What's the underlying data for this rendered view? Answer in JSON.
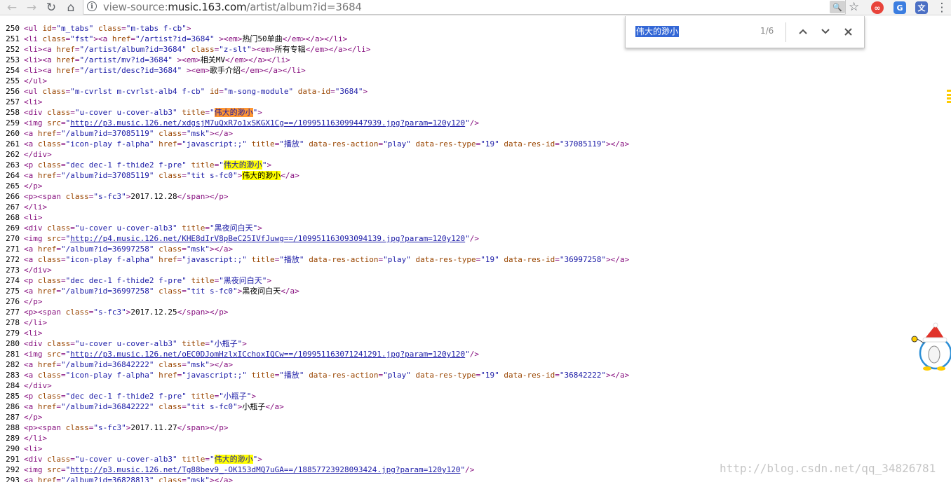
{
  "toolbar": {
    "back_icon": "arrow-back",
    "forward_icon": "arrow-forward",
    "reload_icon": "reload",
    "home_icon": "home",
    "url_scheme": "view-source:",
    "url_host": "music.163.com",
    "url_path": "/artist/album?id=3684",
    "star_icon": "star",
    "find_icon": "find-in-page"
  },
  "find_bar": {
    "query": "伟大的渺小",
    "count": "1/6",
    "prev_icon": "chevron-up",
    "next_icon": "chevron-down",
    "close_icon": "close"
  },
  "watermark": "http://blog.csdn.net/qq_34826781",
  "colors": {
    "match_highlight": "#ffff00",
    "active_match": "#ff9632",
    "tag": "#881280",
    "attr": "#994500",
    "value": "#1a1aa6"
  },
  "lines": [
    {
      "n": "250",
      "code": "<ul id=\"m_tabs\" class=\"m-tabs f-cb\">"
    },
    {
      "n": "251",
      "code": "<li class=\"fst\"><a href=\"/artist?id=3684\" ><em>热门50单曲</em></a></li>"
    },
    {
      "n": "252",
      "code": "<li><a href=\"/artist/album?id=3684\" class=\"z-slt\"><em>所有专辑</em></a></li>"
    },
    {
      "n": "253",
      "code": "<li><a href=\"/artist/mv?id=3684\" ><em>相关MV</em></a></li>"
    },
    {
      "n": "254",
      "code": "<li><a href=\"/artist/desc?id=3684\" ><em>歌手介绍</em></a></li>"
    },
    {
      "n": "255",
      "code": "</ul>"
    },
    {
      "n": "256",
      "code": "<ul class=\"m-cvrlst m-cvrlst-alb4 f-cb\" id=\"m-song-module\" data-id=\"3684\">"
    },
    {
      "n": "257",
      "code": "<li>"
    },
    {
      "n": "258",
      "code": "<div class=\"u-cover u-cover-alb3\" title=\"伟大的渺小\">"
    },
    {
      "n": "259",
      "code": "<img src=\"http://p3.music.126.net/xdgsjM7uQxR7o1xSKGX1Cg==/109951163099447939.jpg?param=120y120\"/>"
    },
    {
      "n": "260",
      "code": "<a href=\"/album?id=37085119\" class=\"msk\"></a>"
    },
    {
      "n": "261",
      "code": "<a class=\"icon-play f-alpha\" href=\"javascript:;\" title=\"播放\" data-res-action=\"play\" data-res-type=\"19\" data-res-id=\"37085119\"></a>"
    },
    {
      "n": "262",
      "code": "</div>"
    },
    {
      "n": "263",
      "code": "<p class=\"dec dec-1 f-thide2 f-pre\" title=\"伟大的渺小\">"
    },
    {
      "n": "264",
      "code": "<a href=\"/album?id=37085119\" class=\"tit s-fc0\">伟大的渺小</a>"
    },
    {
      "n": "265",
      "code": "</p>"
    },
    {
      "n": "266",
      "code": "<p><span class=\"s-fc3\">2017.12.28</span></p>"
    },
    {
      "n": "267",
      "code": "</li>"
    },
    {
      "n": "268",
      "code": "<li>"
    },
    {
      "n": "269",
      "code": "<div class=\"u-cover u-cover-alb3\" title=\"黑夜问白天\">"
    },
    {
      "n": "270",
      "code": "<img src=\"http://p4.music.126.net/KHE8dIrV8pBeC25IVfJuwg==/109951163093094139.jpg?param=120y120\"/>"
    },
    {
      "n": "271",
      "code": "<a href=\"/album?id=36997258\" class=\"msk\"></a>"
    },
    {
      "n": "272",
      "code": "<a class=\"icon-play f-alpha\" href=\"javascript:;\" title=\"播放\" data-res-action=\"play\" data-res-type=\"19\" data-res-id=\"36997258\"></a>"
    },
    {
      "n": "273",
      "code": "</div>"
    },
    {
      "n": "274",
      "code": "<p class=\"dec dec-1 f-thide2 f-pre\" title=\"黑夜问白天\">"
    },
    {
      "n": "275",
      "code": "<a href=\"/album?id=36997258\" class=\"tit s-fc0\">黑夜问白天</a>"
    },
    {
      "n": "276",
      "code": "</p>"
    },
    {
      "n": "277",
      "code": "<p><span class=\"s-fc3\">2017.12.25</span></p>"
    },
    {
      "n": "278",
      "code": "</li>"
    },
    {
      "n": "279",
      "code": "<li>"
    },
    {
      "n": "280",
      "code": "<div class=\"u-cover u-cover-alb3\" title=\"小瓶子\">"
    },
    {
      "n": "281",
      "code": "<img src=\"http://p3.music.126.net/oEC0DJomHzlxICchoxIQCw==/109951163071241291.jpg?param=120y120\"/>"
    },
    {
      "n": "282",
      "code": "<a href=\"/album?id=36842222\" class=\"msk\"></a>"
    },
    {
      "n": "283",
      "code": "<a class=\"icon-play f-alpha\" href=\"javascript:;\" title=\"播放\" data-res-action=\"play\" data-res-type=\"19\" data-res-id=\"36842222\"></a>"
    },
    {
      "n": "284",
      "code": "</div>"
    },
    {
      "n": "285",
      "code": "<p class=\"dec dec-1 f-thide2 f-pre\" title=\"小瓶子\">"
    },
    {
      "n": "286",
      "code": "<a href=\"/album?id=36842222\" class=\"tit s-fc0\">小瓶子</a>"
    },
    {
      "n": "287",
      "code": "</p>"
    },
    {
      "n": "288",
      "code": "<p><span class=\"s-fc3\">2017.11.27</span></p>"
    },
    {
      "n": "289",
      "code": "</li>"
    },
    {
      "n": "290",
      "code": "<li>"
    },
    {
      "n": "291",
      "code": "<div class=\"u-cover u-cover-alb3\" title=\"伟大的渺小\">"
    },
    {
      "n": "292",
      "code": "<img src=\"http://p3.music.126.net/Tg88bev9_-OK153dMQ7uGA==/18857723928093424.jpg?param=120y120\"/>"
    },
    {
      "n": "293",
      "code": "<a href=\"/album?id=36828813\" class=\"msk\"></a>"
    }
  ]
}
